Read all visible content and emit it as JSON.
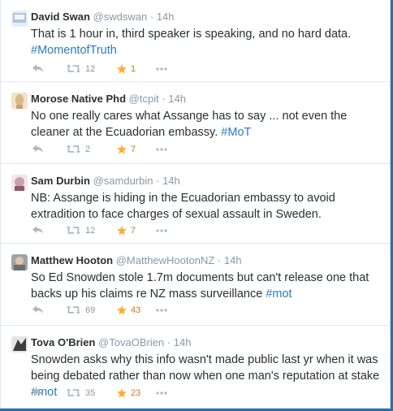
{
  "tweets": [
    {
      "name": "David Swan",
      "handle": "@swdswan",
      "time": "14h",
      "text": "That is 1 hour in, third speaker is speaking, and no hard data.",
      "hashtag": "#MomentofTruth",
      "retweets": "12",
      "favorites": "1",
      "avatar_color": "#b0c4de"
    },
    {
      "name": "Morose Native Phd",
      "handle": "@tcpit",
      "time": "14h",
      "text": "No one really cares what Assange has to say ... not even the cleaner at the Ecuadorian embassy.",
      "hashtag": "#MoT",
      "retweets": "2",
      "favorites": "7",
      "avatar_color": "#d9b88a"
    },
    {
      "name": "Sam Durbin",
      "handle": "@samdurbin",
      "time": "14h",
      "text": "NB: Assange is hiding in the Ecuadorian embassy to avoid extradition to face charges of sexual assault in Sweden.",
      "hashtag": "",
      "retweets": "12",
      "favorites": "7",
      "avatar_color": "#c9a0b0"
    },
    {
      "name": "Matthew Hooton",
      "handle": "@MatthewHootonNZ",
      "time": "14h",
      "text": "So Ed Snowden stole 1.7m documents but can't release one that backs up his claims re NZ mass surveillance",
      "hashtag": "#mot",
      "retweets": "69",
      "favorites": "43",
      "avatar_color": "#6b6e70"
    },
    {
      "name": "Tova O'Brien",
      "handle": "@TovaOBrien",
      "time": "14h",
      "text": "Snowden asks why this info wasn't made public last yr when it was being debated rather than now when one man's reputation at stake",
      "hashtag": "#mot",
      "retweets": "35",
      "favorites": "23",
      "avatar_color": "#3d3d3d"
    }
  ],
  "separator": "·",
  "colors": {
    "link": "#2b7bb9",
    "muted": "#8899a6",
    "star": "#ffac33",
    "frame": "#2b6fa8"
  },
  "icons": {
    "reply": "reply-icon",
    "retweet": "retweet-icon",
    "favorite": "star-icon",
    "more": "more-icon"
  }
}
